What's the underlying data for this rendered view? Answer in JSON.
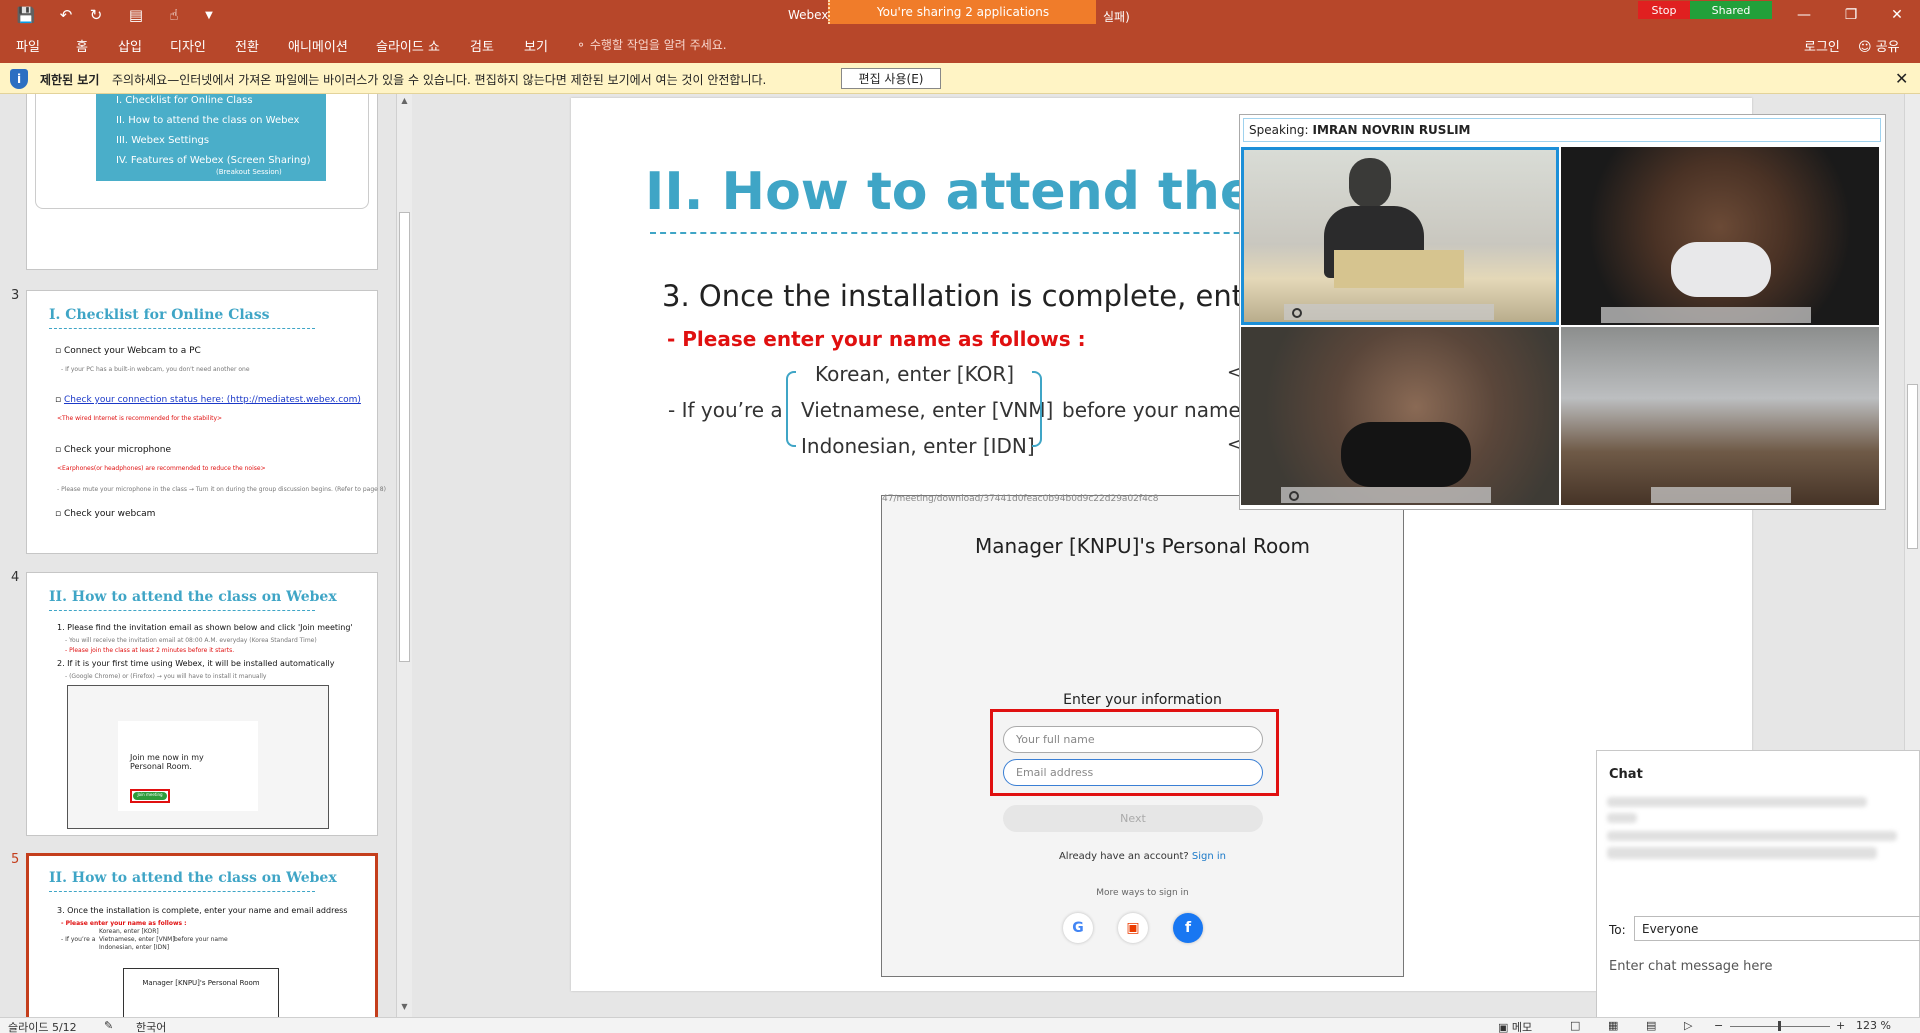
{
  "titlebar": {
    "title": "Webex",
    "title_suffix": "실패)",
    "share_banner": "You're sharing 2 applications",
    "stop_label": "Stop",
    "shared_label": "Shared",
    "accent": "#b7472a"
  },
  "ribbon": {
    "tabs": [
      "파일",
      "홈",
      "삽입",
      "디자인",
      "전환",
      "애니메이션",
      "슬라이드 쇼",
      "검토",
      "보기"
    ],
    "tell_me": "수행할 작업을 알려 주세요.",
    "login": "로그인",
    "share": "공유"
  },
  "protected_view": {
    "title": "제한된 보기",
    "message": "주의하세요—인터넷에서 가져온 파일에는 바이러스가 있을 수 있습니다. 편집하지 않는다면 제한된 보기에서 여는 것이 안전합니다.",
    "enable_button": "편집 사용(E)"
  },
  "thumbnails": {
    "toc": [
      "I. Checklist for Online Class",
      "II. How to attend the class on Webex",
      "III. Webex Settings",
      "IV. Features of Webex (Screen Sharing)",
      "(Breakout Session)"
    ],
    "slide3": {
      "number": "3",
      "title": "I. Checklist for Online Class",
      "items": [
        "Connect your Webcam to a PC",
        "Check your connection status here: (http://mediatest.webex.com)",
        "Check your microphone",
        "Check your webcam"
      ],
      "notes": [
        "- If your PC has a built-in webcam, you don't need another one",
        "<The wired Internet is recommended for the stability>",
        "<Earphones(or headphones) are recommended to reduce the noise>",
        "- Please mute your microphone in the class → Turn it on during the group discussion begins. (Refer to page 8)"
      ]
    },
    "slide4": {
      "number": "4",
      "title": "II. How to attend the class on Webex",
      "items": [
        "1. Please find the invitation email as shown below and click 'Join meeting'",
        "2. If it is your first time using Webex, it will be installed automatically"
      ],
      "notes": [
        "- You will receive the invitation email at 08:00 A.M. everyday (Korea Standard Time)",
        "- Please join the class at least 2 minutes before it starts.",
        "- (Google Chrome) or (Firefox) → you will have to install it manually"
      ],
      "email_preview": "Join me now in my Personal Room.",
      "email_button": "Join meeting"
    },
    "slide5": {
      "number": "5",
      "title": "II. How to attend the class on Webex",
      "item": "3. Once the installation is complete, enter your name and email address",
      "red": "- Please enter your name as follows :",
      "room": "Manager [KNPU]'s Personal Room"
    }
  },
  "slide": {
    "title": "II. How to attend the clas",
    "step": "3. Once the installation is complete, enter y",
    "red_note": "- Please enter your name as follows :",
    "if_prefix": "- If you’re a",
    "options": [
      "Korean, enter [KOR]",
      "Vietnamese, enter [VNM]",
      "Indonesian, enter [IDN]"
    ],
    "before": "before your name",
    "lt": "<",
    "browser": {
      "url": "47/meeting/download/37441d0feac0b94b0d9c22d29a02f4c8",
      "room_title": "Manager [KNPU]'s Personal Room",
      "enter_info": "Enter your information",
      "name_placeholder": "Your full name",
      "email_placeholder": "Email address",
      "next": "Next",
      "already": "Already have an account?",
      "signin": "Sign in",
      "more_ways": "More ways to sign in"
    }
  },
  "webex": {
    "speaking_label": "Speaking:",
    "speaker": "IMRAN NOVRIN RUSLIM"
  },
  "chat": {
    "title": "Chat",
    "to_label": "To:",
    "to_value": "Everyone",
    "placeholder": "Enter chat message here"
  },
  "statusbar": {
    "slide_pos": "슬라이드 5/12",
    "language": "한국어",
    "notes": "메모",
    "zoom": "123 %"
  }
}
